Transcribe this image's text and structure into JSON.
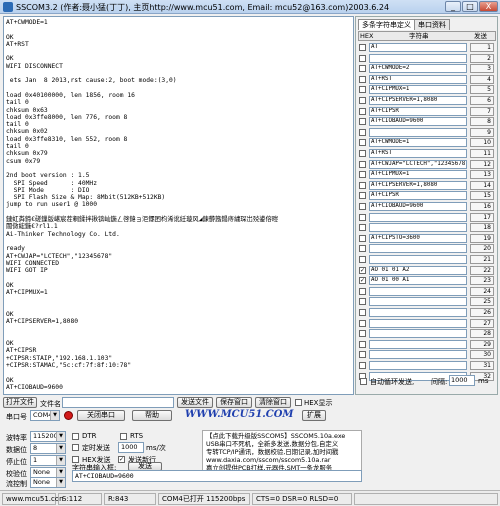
{
  "window": {
    "title": "SSCOM3.2 (作者:聂小猛(丁丁), 主页http://www.mcu51.com,  Email: mcu52@163.com)2003.6.24",
    "min_label": "_",
    "max_label": "□",
    "close_label": "X"
  },
  "receive": {
    "lines": [
      "AT+CWMODE=1",
      "",
      "OK",
      "AT+RST",
      "",
      "OK",
      "WIFI DISCONNECT",
      "",
      " ets Jan  8 2013,rst cause:2, boot mode:(3,0)",
      "",
      "load 0x40100000, len 1856, room 16",
      "tail 0",
      "chksum 0x63",
      "load 0x3ffe8000, len 776, room 8",
      "tail 0",
      "chksum 0x02",
      "load 0x3ffe8310, len 552, room 8",
      "tail 0",
      "chksum 0x79",
      "csum 0x79",
      "",
      "2nd boot version : 1.5",
      "  SPI Speed      : 40MHz",
      "  SPI Mode       : DIO",
      "  SPI Flash Size & Map: 8Mbit(512KB+512KB)",
      "jump to run user1 @ 1000",
      "",
      "鏈虹粦鍗€磋鏁版嵁宸茬粡鍒拌揪锛屾鍦ㄥ啓鍏ョ洰鏍囨枃浠讹紝璇风◢鍊欎簬鍚庤繍琛岀殑鍙傛暟",
      "閫傚綋鍦€?rl1.1",
      "Ai-Thinker Technology Co. Ltd.",
      "",
      "ready",
      "AT+CWJAP=\"LCTECH\",\"12345678\"",
      "WIFI CONNECTED",
      "WIFI GOT IP",
      "",
      "OK",
      "AT+CIPMUX=1",
      "",
      "",
      "OK",
      "AT+CIPSERVER=1,8080",
      "",
      "",
      "OK",
      "AT+CIPSR",
      "+CIPSR:STAIP,\"192.168.1.103\"",
      "+CIPSR:STAMAC,\"5c:cf:7f:8f:10:78\"",
      "",
      "OK",
      "AT+CIOBAUD=9600",
      "",
      "OK"
    ]
  },
  "multi_panel": {
    "tab_multi": "多条字符串定义",
    "tab_serial": "串口资料",
    "col_hex": "HEX",
    "col_string": "字符串",
    "col_send": "发送",
    "rows": [
      {
        "checked": false,
        "text": "AT",
        "num": "1"
      },
      {
        "checked": false,
        "text": "",
        "num": "2"
      },
      {
        "checked": false,
        "text": "AT+CWMODE=2",
        "num": "3"
      },
      {
        "checked": false,
        "text": "AT+RST",
        "num": "4"
      },
      {
        "checked": false,
        "text": "AT+CIPMUX=1",
        "num": "5"
      },
      {
        "checked": false,
        "text": "AT+CIPSERVER=1,8080",
        "num": "6"
      },
      {
        "checked": false,
        "text": "AT+CIPSR",
        "num": "7"
      },
      {
        "checked": false,
        "text": "AT+CIOBAUD=9600",
        "num": "8"
      },
      {
        "checked": false,
        "text": "",
        "num": "9"
      },
      {
        "checked": false,
        "text": "AT+CWMODE=1",
        "num": "10"
      },
      {
        "checked": false,
        "text": "AT+RST",
        "num": "11"
      },
      {
        "checked": false,
        "text": "AT+CWJAP=\"LCTECH\",\"12345678\"",
        "num": "12"
      },
      {
        "checked": false,
        "text": "AT+CIPMUX=1",
        "num": "13"
      },
      {
        "checked": false,
        "text": "AT+CIPSERVER=1,8080",
        "num": "14"
      },
      {
        "checked": false,
        "text": "AT+CIPSR",
        "num": "15"
      },
      {
        "checked": false,
        "text": "AT+CIOBAUD=9600",
        "num": "16"
      },
      {
        "checked": false,
        "text": "",
        "num": "17"
      },
      {
        "checked": false,
        "text": "",
        "num": "18"
      },
      {
        "checked": false,
        "text": "AT+CIPSTO=3600",
        "num": "19"
      },
      {
        "checked": false,
        "text": "",
        "num": "20"
      },
      {
        "checked": false,
        "text": "",
        "num": "21"
      },
      {
        "checked": true,
        "text": "AO 01 01 A2",
        "num": "22"
      },
      {
        "checked": true,
        "text": "AO 01 00 A1",
        "num": "23"
      },
      {
        "checked": false,
        "text": "",
        "num": "24"
      },
      {
        "checked": false,
        "text": "",
        "num": "25"
      },
      {
        "checked": false,
        "text": "",
        "num": "26"
      },
      {
        "checked": false,
        "text": "",
        "num": "27"
      },
      {
        "checked": false,
        "text": "",
        "num": "28"
      },
      {
        "checked": false,
        "text": "",
        "num": "29"
      },
      {
        "checked": false,
        "text": "",
        "num": "30"
      },
      {
        "checked": false,
        "text": "",
        "num": "31"
      },
      {
        "checked": false,
        "text": "",
        "num": "32"
      }
    ],
    "loop_label": "自动循环发送,",
    "interval_label": "间隔:",
    "interval_value": "1000",
    "interval_unit": "ms"
  },
  "controls": {
    "open_file": "打开文件",
    "file_name_label": "文件名",
    "send_file": "发送文件",
    "save_window": "保存窗口",
    "clear_window": "清除窗口",
    "hex_display": "HEX显示",
    "port_label": "串口号",
    "port_value": "COM4",
    "close_port": "关闭串口",
    "help": "帮助",
    "brand": "WWW.MCU51.COM",
    "expand": "扩展",
    "baud_label": "波特率",
    "baud_value": "115200",
    "databits_label": "数据位",
    "databits_value": "8",
    "stopbits_label": "停止位",
    "stopbits_value": "1",
    "parity_label": "校验位",
    "parity_value": "None",
    "flow_label": "流控制",
    "flow_value": "None",
    "dtr": "DTR",
    "rts": "RTS",
    "timed_send": "定时发送",
    "timed_value": "1000",
    "timed_unit": "ms/次",
    "hex_send": "HEX发送",
    "send_newline": "发送新行",
    "send_input_label": "字符串输入框:",
    "send_button": "发送",
    "send_value": "AT+CIOBAUD=9600",
    "ad_lines": [
      "【点此下载升级版SSCOM5】SSCOM5.10a.exe",
      "USB串口不死机，全新多发送,数据分包,自定义",
      "专转TCP/IP通讯，数据校验,日期记录,加时间戳",
      "www.daxia.com/sscom/sscom5.10a.rar",
      "嘉立创提供PCB打样,元器件,SMT一条龙服务"
    ]
  },
  "status": {
    "site": "www.mcu51.con",
    "sent": "S:112",
    "received": "R:843",
    "port_info": "COM4已打开  115200bps",
    "signals": "CTS=0 DSR=0 RLSD=0"
  }
}
